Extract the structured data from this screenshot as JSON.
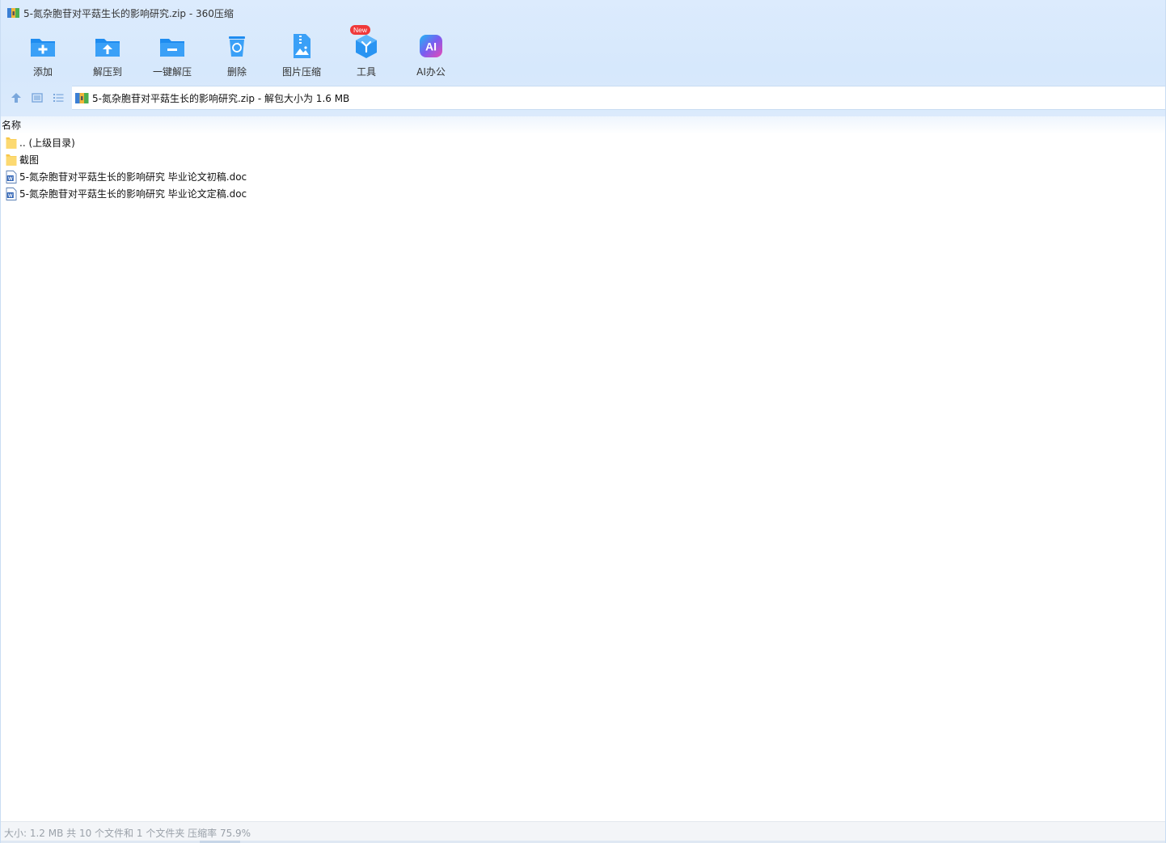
{
  "window": {
    "title": "5-氮杂胞苷对平菇生长的影响研究.zip - 360压缩"
  },
  "toolbar": {
    "buttons": [
      {
        "label": "添加",
        "icon": "add-folder-icon"
      },
      {
        "label": "解压到",
        "icon": "extract-to-icon"
      },
      {
        "label": "一键解压",
        "icon": "one-click-extract-icon"
      },
      {
        "label": "删除",
        "icon": "recycle-bin-icon"
      },
      {
        "label": "图片压缩",
        "icon": "image-compress-icon"
      },
      {
        "label": "工具",
        "icon": "tools-cube-icon",
        "badge": "New"
      },
      {
        "label": "AI办公",
        "icon": "ai-office-icon",
        "icon_text": "AI"
      }
    ]
  },
  "navigation": {
    "up_icon": "up-arrow-icon",
    "thumbnail_view_icon": "thumbnail-view-icon",
    "list_view_icon": "list-view-icon"
  },
  "address_bar": {
    "text": "5-氮杂胞苷对平菇生长的影响研究.zip - 解包大小为 1.6 MB"
  },
  "file_list": {
    "column_name": "名称",
    "rows": [
      {
        "name": ".. (上级目录)",
        "type": "folder"
      },
      {
        "name": "截图",
        "type": "folder"
      },
      {
        "name": "5-氮杂胞苷对平菇生长的影响研究 毕业论文初稿.doc",
        "type": "doc"
      },
      {
        "name": "5-氮杂胞苷对平菇生长的影响研究 毕业论文定稿.doc",
        "type": "doc"
      }
    ]
  },
  "status_bar": {
    "text": "大小: 1.2 MB 共 10 个文件和 1 个文件夹 压缩率 75.9%"
  },
  "colors": {
    "header_bg": "#d8e9fc",
    "icon_blue": "#1e8cf0",
    "badge_red": "#f0393a",
    "folder_yellow": "#fcd971"
  }
}
